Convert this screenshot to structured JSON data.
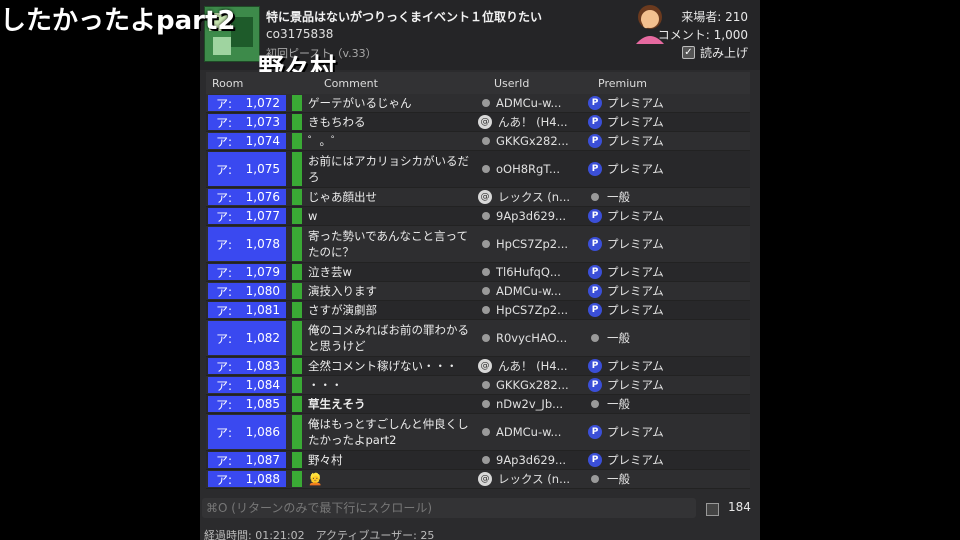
{
  "overlay": {
    "title": "したかったよpart2",
    "viewer_name": "野々村"
  },
  "header": {
    "title": "特に景品はないがつりっくまイベント１位取りたい",
    "community": "co3175838",
    "program": "初回ピースト（v.33）",
    "visitors": "来場者: 210",
    "comments": "コメント: 1,000",
    "read_aloud": "読み上げ",
    "read_aloud_checked": "✓",
    "emoji_icon": "person-facepalming-icon"
  },
  "columns": {
    "room": "Room",
    "comment": "Comment",
    "userid": "UserId",
    "premium": "Premium"
  },
  "rows": [
    {
      "room": "ア:",
      "num": "1,072",
      "comment": "ゲーテがいるじゃん",
      "user": "ADMCu-w...",
      "user_icon": "dot",
      "premium": "プレミアム",
      "prem": true
    },
    {
      "room": "ア:",
      "num": "1,073",
      "comment": "きもちわる",
      "user": "んあ！ (H4...",
      "user_icon": "at",
      "premium": "プレミアム",
      "prem": true
    },
    {
      "room": "ア:",
      "num": "1,074",
      "comment": "゜。゜",
      "user": "GKKGx282...",
      "user_icon": "dot",
      "premium": "プレミアム",
      "prem": true
    },
    {
      "room": "ア:",
      "num": "1,075",
      "comment": "お前にはアカリョシカがいるだろ",
      "user": "oOH8RgT...",
      "user_icon": "dot",
      "premium": "プレミアム",
      "prem": true
    },
    {
      "room": "ア:",
      "num": "1,076",
      "comment": "じゃあ顔出せ",
      "user": "レックス (n...",
      "user_icon": "at",
      "premium": "一般",
      "prem": false
    },
    {
      "room": "ア:",
      "num": "1,077",
      "comment": "w",
      "user": "9Ap3d629...",
      "user_icon": "dot",
      "premium": "プレミアム",
      "prem": true
    },
    {
      "room": "ア:",
      "num": "1,078",
      "comment": "寄った勢いであんなこと言ってたのに？",
      "user": "HpCS7Zp2...",
      "user_icon": "dot",
      "premium": "プレミアム",
      "prem": true
    },
    {
      "room": "ア:",
      "num": "1,079",
      "comment": "泣き芸w",
      "user": "Tl6HufqQ...",
      "user_icon": "dot",
      "premium": "プレミアム",
      "prem": true
    },
    {
      "room": "ア:",
      "num": "1,080",
      "comment": "演技入ります",
      "user": "ADMCu-w...",
      "user_icon": "dot",
      "premium": "プレミアム",
      "prem": true
    },
    {
      "room": "ア:",
      "num": "1,081",
      "comment": "さすが演劇部",
      "user": "HpCS7Zp2...",
      "user_icon": "dot",
      "premium": "プレミアム",
      "prem": true
    },
    {
      "room": "ア:",
      "num": "1,082",
      "comment": "俺のコメみればお前の罪わかると思うけど",
      "user": "R0vycHAO...",
      "user_icon": "dot",
      "premium": "一般",
      "prem": false
    },
    {
      "room": "ア:",
      "num": "1,083",
      "comment": "全然コメント稼げない・・・",
      "user": "んあ！ (H4...",
      "user_icon": "at",
      "premium": "プレミアム",
      "prem": true
    },
    {
      "room": "ア:",
      "num": "1,084",
      "comment": "・・・",
      "user": "GKKGx282...",
      "user_icon": "dot",
      "premium": "プレミアム",
      "prem": true
    },
    {
      "room": "ア:",
      "num": "1,085",
      "comment": "草生えそう",
      "user": "nDw2v_Jb...",
      "user_icon": "dot",
      "premium": "一般",
      "prem": false,
      "bold": true
    },
    {
      "room": "ア:",
      "num": "1,086",
      "comment": "俺はもっとすごしんと仲良くしたかったよpart2",
      "user": "ADMCu-w...",
      "user_icon": "dot",
      "premium": "プレミアム",
      "prem": true
    },
    {
      "room": "ア:",
      "num": "1,087",
      "comment": "野々村",
      "user": "9Ap3d629...",
      "user_icon": "dot",
      "premium": "プレミアム",
      "prem": true
    },
    {
      "room": "ア:",
      "num": "1,088",
      "comment": "👱",
      "user": "レックス (n...",
      "user_icon": "at",
      "premium": "一般",
      "prem": false
    }
  ],
  "input": {
    "placeholder": "⌘O (リターンのみで最下行にスクロール)"
  },
  "count": "184",
  "footer": "経過時間: 01:21:02　アクティブユーザー: 25",
  "colors": {
    "room_bg": "#3a49f0",
    "bar": "#3aaa35",
    "premium_badge": "#3b4fd8"
  }
}
